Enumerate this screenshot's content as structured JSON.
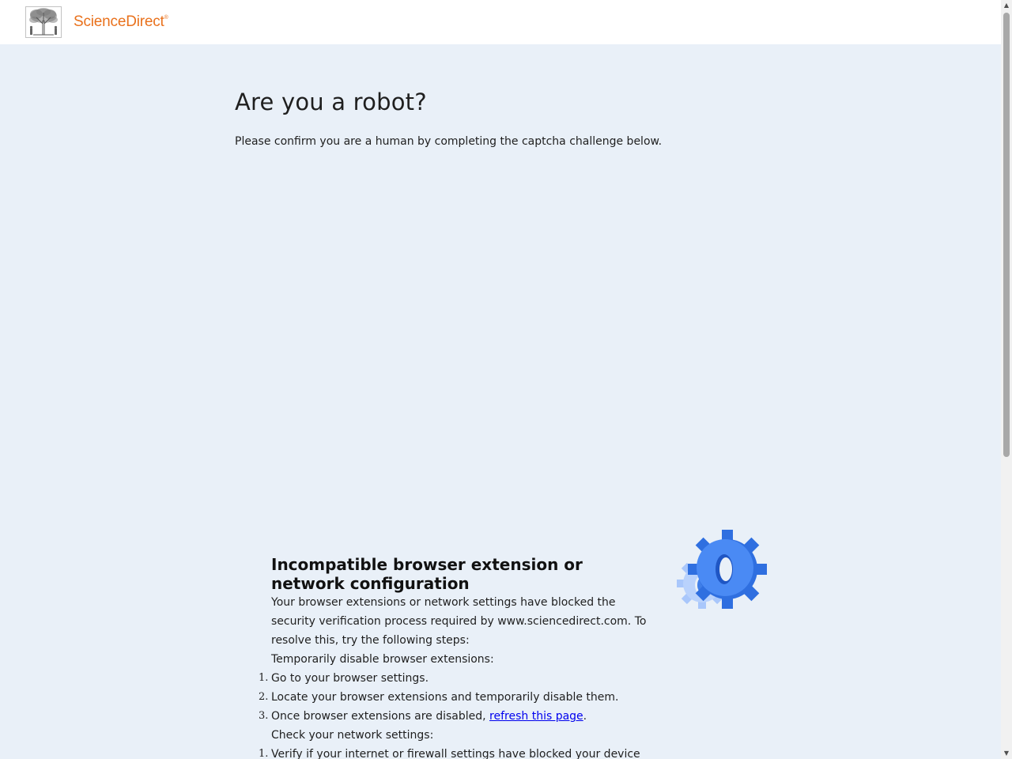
{
  "header": {
    "brand_name": "ScienceDirect",
    "brand_mark": "®",
    "logo_icon": "elsevier-tree-icon",
    "brand_color": "#e9711c"
  },
  "main": {
    "title": "Are you a robot?",
    "intro": "Please confirm you are a human by completing the captcha challenge below."
  },
  "error": {
    "title": "Incompatible browser extension or network configuration",
    "description": "Your browser extensions or network settings have blocked the security verification process required by www.sciencedirect.com. To resolve this, try the following steps:",
    "section1_label": "Temporarily disable browser extensions:",
    "steps1": [
      {
        "num": "1.",
        "text": "Go to your browser settings."
      },
      {
        "num": "2.",
        "text": "Locate your browser extensions and temporarily disable them."
      },
      {
        "num": "3.",
        "text_before": "Once browser extensions are disabled, ",
        "link_text": "refresh this page",
        "text_after": "."
      }
    ],
    "section2_label": "Check your network settings:",
    "steps2": [
      {
        "num": "1.",
        "text": "Verify if your internet or firewall settings have blocked your device from"
      }
    ],
    "illustration_icon": "gears-icon",
    "gear_color": "#3b82f6"
  },
  "colors": {
    "page_background": "#e9f0f8",
    "link": "#0000ee"
  }
}
